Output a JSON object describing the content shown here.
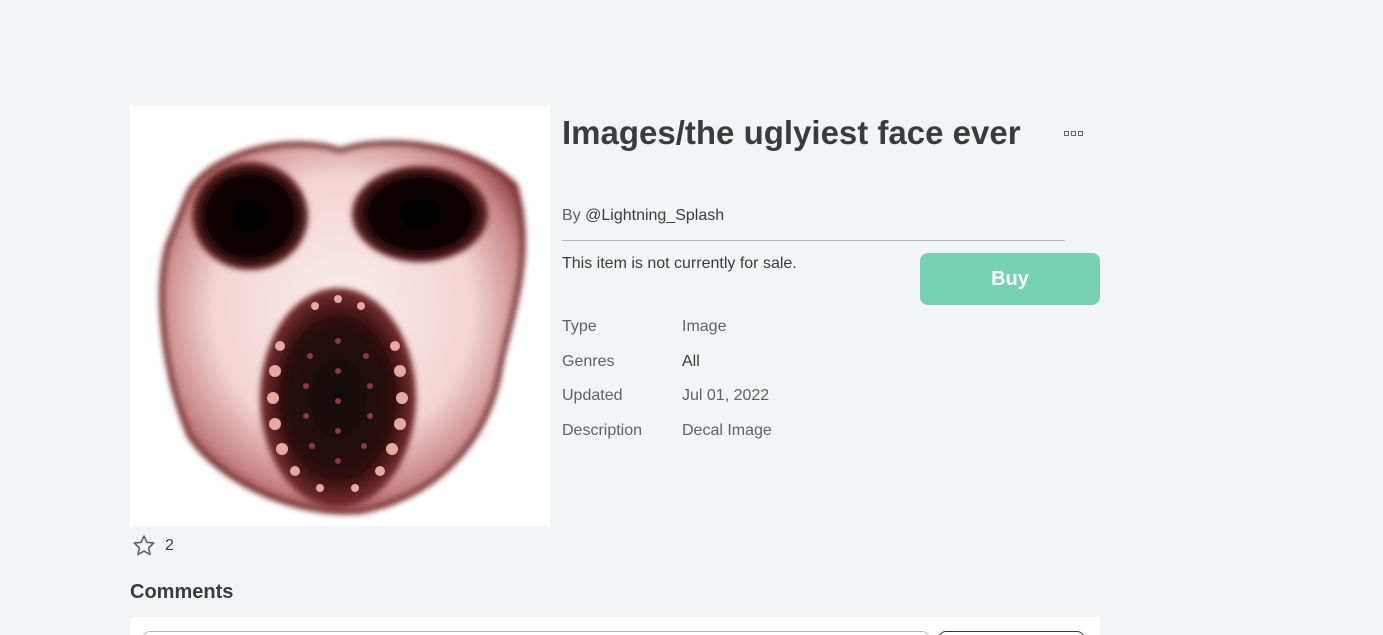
{
  "item": {
    "title": "Images/the uglyiest face ever",
    "by_prefix": "By",
    "creator": "@Lightning_Splash",
    "sale_status": "This item is not currently for sale.",
    "buy_label": "Buy",
    "thumbnail_icon": "decal-image",
    "more_icon": "ellipsis-icon"
  },
  "details": [
    {
      "label": "Type",
      "value": "Image"
    },
    {
      "label": "Genres",
      "value": "All"
    },
    {
      "label": "Updated",
      "value": "Jul 01, 2022"
    },
    {
      "label": "Description",
      "value": "Decal Image"
    }
  ],
  "favorites": {
    "icon": "star-icon",
    "count": "2"
  },
  "comments": {
    "title": "Comments"
  },
  "colors": {
    "background": "#f2f4f5",
    "buy_button": "#76d1b2",
    "text": "#393b3d",
    "muted": "#606162"
  }
}
